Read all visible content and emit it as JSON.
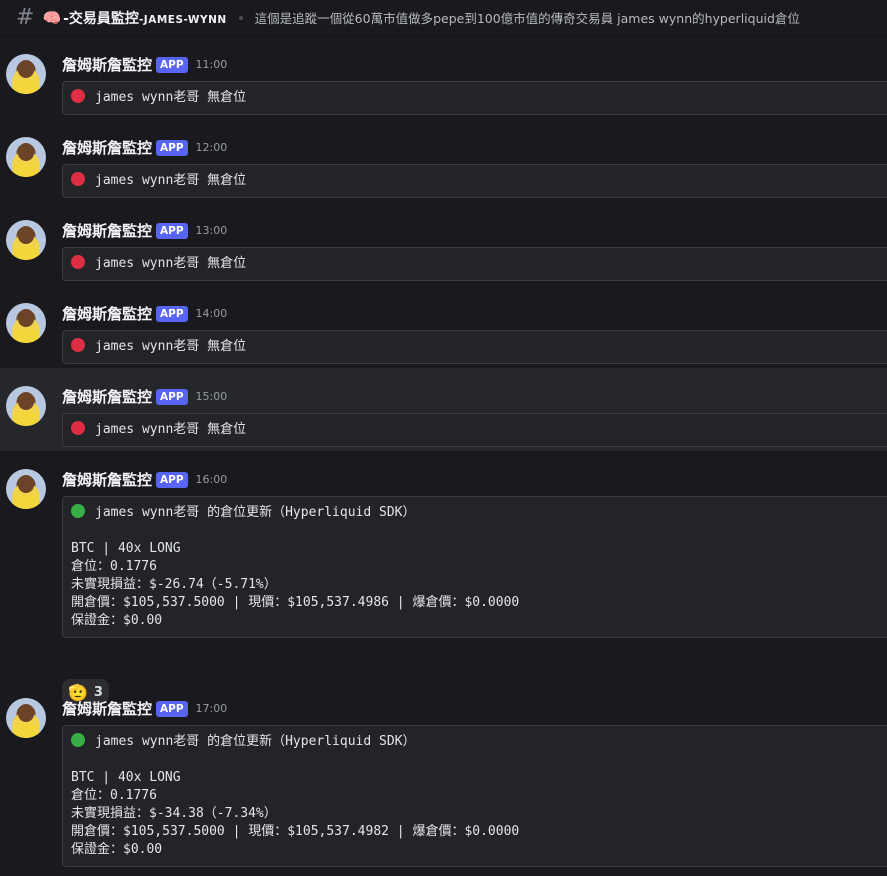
{
  "header": {
    "hash": "#",
    "channel_emoji": "🧠",
    "channel_cn": "-交易員監控",
    "channel_en": "-JAMES-WYNN",
    "topic": "這個是追蹤一個從60萬市值做多pepe到100億市值的傳奇交易員 james wynn的hyperliquid倉位"
  },
  "author": "詹姆斯詹監控",
  "app_tag": "APP",
  "messages": [
    {
      "time": "11:00",
      "line": "james wynn老哥 無倉位"
    },
    {
      "time": "12:00",
      "line": "james wynn老哥 無倉位"
    },
    {
      "time": "13:00",
      "line": "james wynn老哥 無倉位"
    },
    {
      "time": "14:00",
      "line": "james wynn老哥 無倉位"
    },
    {
      "time": "15:00",
      "line": "james wynn老哥 無倉位"
    },
    {
      "time": "16:00",
      "line": "james wynn老哥 的倉位更新（Hyperliquid SDK）",
      "l1": "BTC | 40x LONG",
      "l2": "倉位：0.1776",
      "l3": "未實現損益：$-26.74（-5.71%）",
      "l4": "開倉價：$105,537.5000 | 現價：$105,537.4986 | 爆倉價：$0.0000",
      "l5": "保證金：$0.00",
      "reaction": {
        "emoji": "🫡",
        "count": "3"
      }
    },
    {
      "time": "17:00",
      "line": "james wynn老哥 的倉位更新（Hyperliquid SDK）",
      "l1": "BTC | 40x LONG",
      "l2": "倉位：0.1776",
      "l3": "未實現損益：$-34.38（-7.34%）",
      "l4": "開倉價：$105,537.5000 | 現價：$105,537.4982 | 爆倉價：$0.0000",
      "l5": "保證金：$0.00"
    }
  ],
  "colors": {
    "red_status": "#dd2e44",
    "green_status": "#3aae46",
    "app_tag": "#5865f2"
  }
}
